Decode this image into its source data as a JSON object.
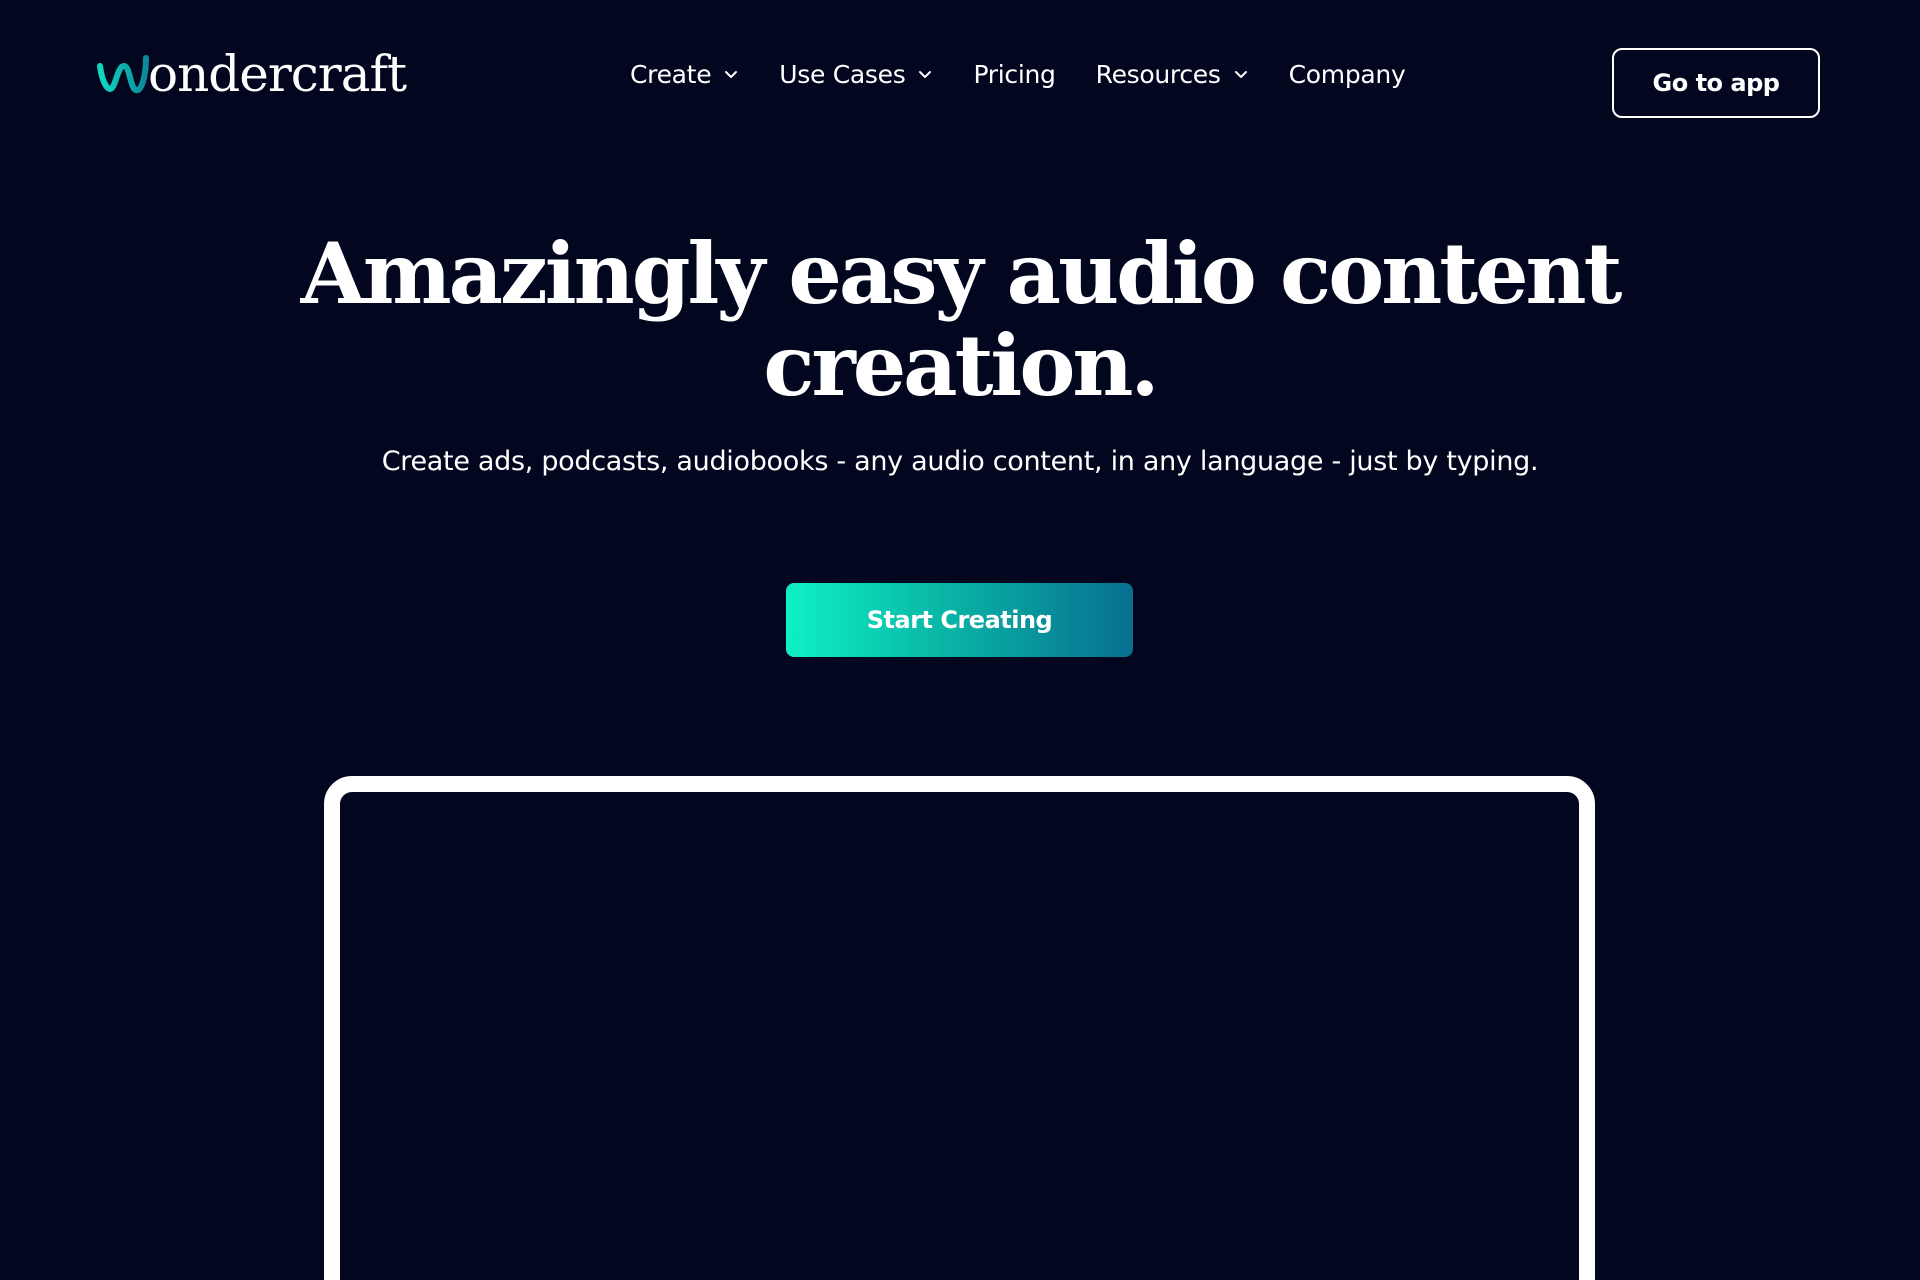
{
  "brand": {
    "logo_text": "ondercraft",
    "accent_gradient": [
      "#0ef0c5",
      "#086f90"
    ],
    "background": "#03061f"
  },
  "nav": {
    "items": [
      {
        "label": "Create",
        "has_dropdown": true,
        "icon": "chevron-down-icon"
      },
      {
        "label": "Use Cases",
        "has_dropdown": true,
        "icon": "chevron-down-icon"
      },
      {
        "label": "Pricing",
        "has_dropdown": false
      },
      {
        "label": "Resources",
        "has_dropdown": true,
        "icon": "chevron-down-icon"
      },
      {
        "label": "Company",
        "has_dropdown": false
      }
    ],
    "go_to_app_label": "Go to app"
  },
  "hero": {
    "title_line1": "Amazingly easy audio content",
    "title_line2": "creation.",
    "subtitle": "Create ads, podcasts, audiobooks - any audio content, in any language - just by typing.",
    "cta_label": "Start Creating"
  }
}
